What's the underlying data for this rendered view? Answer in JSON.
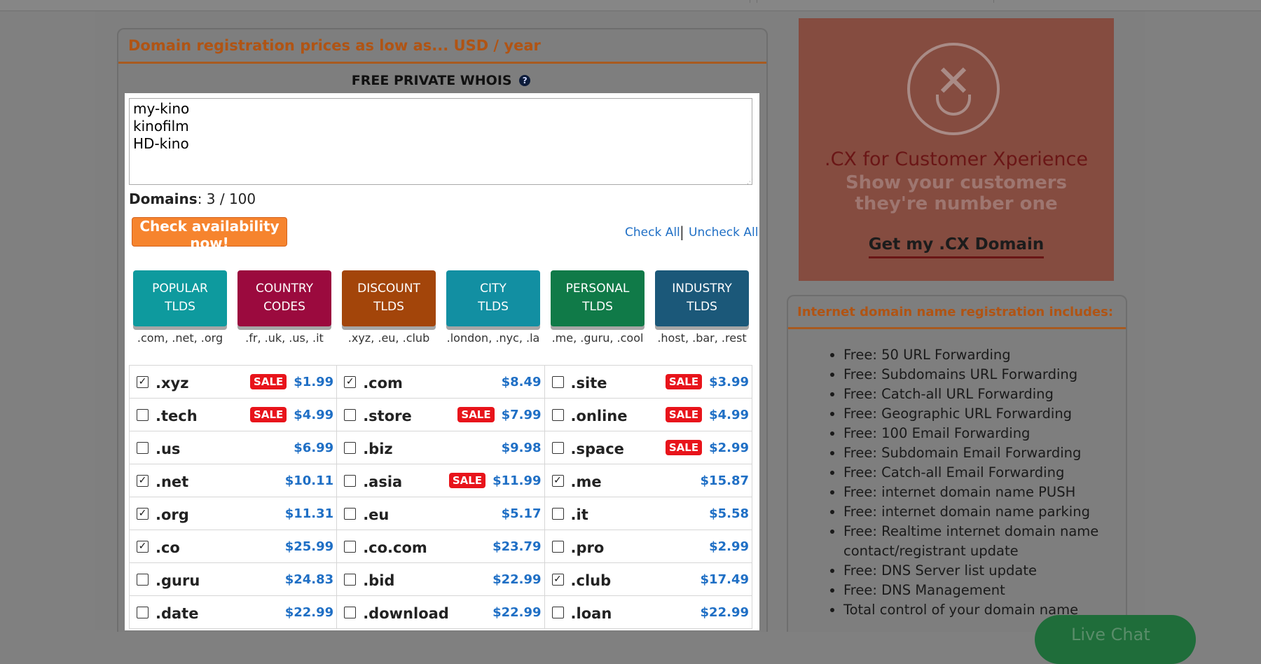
{
  "main": {
    "title": "Domain registration prices as low as... USD / year",
    "whois_label": "FREE PRIVATE WHOIS",
    "whois_help": "?",
    "domains_text": "my-kino\nkinofilm\nHD-kino",
    "domains_count_label": "Domains",
    "domains_count_value": ": 3 / 100",
    "check_button": "Check availability now!",
    "check_all": "Check All",
    "separator": "|",
    "uncheck_all": "Uncheck All"
  },
  "categories": [
    {
      "label1": "POPULAR",
      "label2": "TLDS",
      "sub": ".com, .net, .org",
      "color": "#0e9a9e"
    },
    {
      "label1": "COUNTRY",
      "label2": "CODES",
      "sub": ".fr, .uk, .us, .it",
      "color": "#9b0a3e"
    },
    {
      "label1": "DISCOUNT",
      "label2": "TLDS",
      "sub": ".xyz, .eu, .club",
      "color": "#a3450a"
    },
    {
      "label1": "CITY",
      "label2": "TLDS",
      "sub": ".london, .nyc, .la",
      "color": "#128fa2"
    },
    {
      "label1": "PERSONAL",
      "label2": "TLDS",
      "sub": ".me, .guru, .cool",
      "color": "#107a48"
    },
    {
      "label1": "INDUSTRY",
      "label2": "TLDS",
      "sub": ".host, .bar, .rest",
      "color": "#1b5879"
    }
  ],
  "sale_label": "SALE",
  "tld_rows": [
    [
      {
        "tld": ".xyz",
        "checked": true,
        "sale": true,
        "price": "$1.99"
      },
      {
        "tld": ".com",
        "checked": true,
        "sale": false,
        "price": "$8.49"
      },
      {
        "tld": ".site",
        "checked": false,
        "sale": true,
        "price": "$3.99"
      }
    ],
    [
      {
        "tld": ".tech",
        "checked": false,
        "sale": true,
        "price": "$4.99"
      },
      {
        "tld": ".store",
        "checked": false,
        "sale": true,
        "price": "$7.99"
      },
      {
        "tld": ".online",
        "checked": false,
        "sale": true,
        "price": "$4.99"
      }
    ],
    [
      {
        "tld": ".us",
        "checked": false,
        "sale": false,
        "price": "$6.99"
      },
      {
        "tld": ".biz",
        "checked": false,
        "sale": false,
        "price": "$9.98"
      },
      {
        "tld": ".space",
        "checked": false,
        "sale": true,
        "price": "$2.99"
      }
    ],
    [
      {
        "tld": ".net",
        "checked": true,
        "sale": false,
        "price": "$10.11"
      },
      {
        "tld": ".asia",
        "checked": false,
        "sale": true,
        "price": "$11.99"
      },
      {
        "tld": ".me",
        "checked": true,
        "sale": false,
        "price": "$15.87"
      }
    ],
    [
      {
        "tld": ".org",
        "checked": true,
        "sale": false,
        "price": "$11.31"
      },
      {
        "tld": ".eu",
        "checked": false,
        "sale": false,
        "price": "$5.17"
      },
      {
        "tld": ".it",
        "checked": false,
        "sale": false,
        "price": "$5.58"
      }
    ],
    [
      {
        "tld": ".co",
        "checked": true,
        "sale": false,
        "price": "$25.99"
      },
      {
        "tld": ".co.com",
        "checked": false,
        "sale": false,
        "price": "$23.79"
      },
      {
        "tld": ".pro",
        "checked": false,
        "sale": false,
        "price": "$2.99"
      }
    ],
    [
      {
        "tld": ".guru",
        "checked": false,
        "sale": false,
        "price": "$24.83"
      },
      {
        "tld": ".bid",
        "checked": false,
        "sale": false,
        "price": "$22.99"
      },
      {
        "tld": ".club",
        "checked": true,
        "sale": false,
        "price": "$17.49"
      }
    ],
    [
      {
        "tld": ".date",
        "checked": false,
        "sale": false,
        "price": "$22.99"
      },
      {
        "tld": ".download",
        "checked": false,
        "sale": false,
        "price": "$22.99"
      },
      {
        "tld": ".loan",
        "checked": false,
        "sale": false,
        "price": "$22.99"
      }
    ]
  ],
  "ad": {
    "title": ".CX for Customer Xperience",
    "subtitle": "Show your customers they're number one",
    "cta": "Get my .CX Domain"
  },
  "includes": {
    "title": "Internet domain name registration includes:",
    "items": [
      "Free: 50 URL Forwarding",
      "Free: Subdomains URL Forwarding",
      "Free: Catch-all URL Forwarding",
      "Free: Geographic URL Forwarding",
      "Free: 100 Email Forwarding",
      "Free: Subdomain Email Forwarding",
      "Free: Catch-all Email Forwarding",
      "Free: internet domain name PUSH",
      "Free: internet domain name parking",
      "Free: Realtime internet domain name contact/registrant update",
      "Free: DNS Server list update",
      "Free: DNS Management",
      "Total control of your domain name"
    ]
  },
  "chat": {
    "label": "Live Chat"
  }
}
